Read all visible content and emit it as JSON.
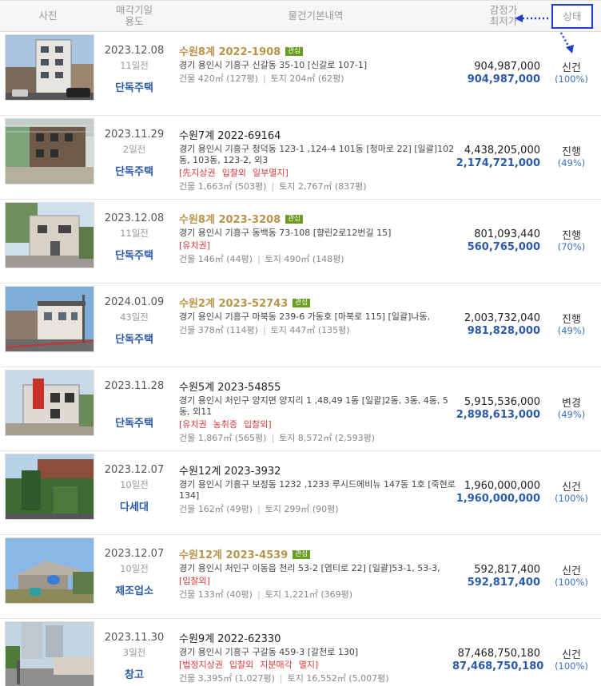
{
  "header": {
    "photo": "사진",
    "date_line1": "매각기일",
    "date_line2": "용도",
    "info": "물건기본내역",
    "price_line1": "감정가",
    "price_line2": "최저가",
    "status": "상태"
  },
  "accent_color": "#1d3fd6",
  "items": [
    {
      "date": "2023.12.08",
      "days": "11일전",
      "usage": "단독주택",
      "case": "수원8계 2022-1908",
      "badge": "관심",
      "address": "경기 용인시 기흥구 신갈동 35-10 [신갈로 107-1]",
      "special": [],
      "building": "건물 420㎡ (127평)",
      "land": "토지 204㎡ (62평)",
      "appraisal": "904,987,000",
      "min_price": "904,987,000",
      "status": "신건",
      "percent": "(100%)"
    },
    {
      "date": "2023.11.29",
      "days": "2일전",
      "usage": "단독주택",
      "case": "수원7계 2022-69164",
      "badge": "",
      "address": "경기 용인시 기흥구 청덕동 123-1 ,124-4 101동 [청마로 22] [일괄]102동, 103동, 123-2, 외3",
      "special": [
        "[先지상권",
        "입찰외",
        "일부멸지]"
      ],
      "building": "건물 1,663㎡ (503평)",
      "land": "토지 2,767㎡ (837평)",
      "appraisal": "4,438,205,000",
      "min_price": "2,174,721,000",
      "status": "진행",
      "percent": "(49%)"
    },
    {
      "date": "2023.12.08",
      "days": "11일전",
      "usage": "단독주택",
      "case": "수원8계 2023-3208",
      "badge": "관심",
      "address": "경기 용인시 기흥구 동백동 73-108 [향린2로12번길 15]",
      "special": [
        "[유치권]"
      ],
      "building": "건물 146㎡ (44평)",
      "land": "토지 490㎡ (148평)",
      "appraisal": "801,093,440",
      "min_price": "560,765,000",
      "status": "진행",
      "percent": "(70%)"
    },
    {
      "date": "2024.01.09",
      "days": "43일전",
      "usage": "단독주택",
      "case": "수원2계 2023-52743",
      "badge": "관심",
      "address": "경기 용인시 기흥구 마북동 239-6 가동호 [마북로 115] [일괄]나동,",
      "special": [],
      "building": "건물 378㎡ (114평)",
      "land": "토지 447㎡ (135평)",
      "appraisal": "2,003,732,040",
      "min_price": "981,828,000",
      "status": "진행",
      "percent": "(49%)"
    },
    {
      "date": "2023.11.28",
      "days": "",
      "usage": "단독주택",
      "case": "수원5계 2023-54855",
      "badge": "",
      "address": "경기 용인시 처인구 양지면 양지리 1 ,48,49 1동 [일괄]2동, 3동, 4동, 5동, 외11",
      "special": [
        "[유치권",
        "농취증",
        "입찰외]"
      ],
      "building": "건물 1,867㎡ (565평)",
      "land": "토지 8,572㎡ (2,593평)",
      "appraisal": "5,915,536,000",
      "min_price": "2,898,613,000",
      "status": "변경",
      "percent": "(49%)"
    },
    {
      "date": "2023.12.07",
      "days": "10일전",
      "usage": "다세대",
      "case": "수원12계 2023-3932",
      "badge": "",
      "address": "경기 용인시 기흥구 보정동 1232 ,1233 루시드에비뉴 147동 1호 [죽현로 134]",
      "special": [],
      "building": "건물 162㎡ (49평)",
      "land": "토지 299㎡ (90평)",
      "appraisal": "1,960,000,000",
      "min_price": "1,960,000,000",
      "status": "신건",
      "percent": "(100%)"
    },
    {
      "date": "2023.12.07",
      "days": "10일전",
      "usage": "제조업소",
      "case": "수원12계 2023-4539",
      "badge": "관심",
      "address": "경기 용인시 처인구 이동읍 천리 53-2 [염티로 22] [일괄]53-1, 53-3,",
      "special": [
        "[입찰외]"
      ],
      "building": "건물 133㎡ (40평)",
      "land": "토지 1,221㎡ (369평)",
      "appraisal": "592,817,400",
      "min_price": "592,817,400",
      "status": "신건",
      "percent": "(100%)"
    },
    {
      "date": "2023.11.30",
      "days": "3일전",
      "usage": "창고",
      "case": "수원9계 2022-62330",
      "badge": "",
      "address": "경기 용인시 기흥구 구갈동 459-3 [갈천로 130]",
      "special": [
        "[법정지상권",
        "입찰외",
        "지분매각",
        "멸지]"
      ],
      "building": "건물 3,395㎡ (1,027평)",
      "land": "토지 16,552㎡ (5,007평)",
      "appraisal": "87,468,750,180",
      "min_price": "87,468,750,180",
      "status": "신건",
      "percent": "(100%)"
    }
  ]
}
